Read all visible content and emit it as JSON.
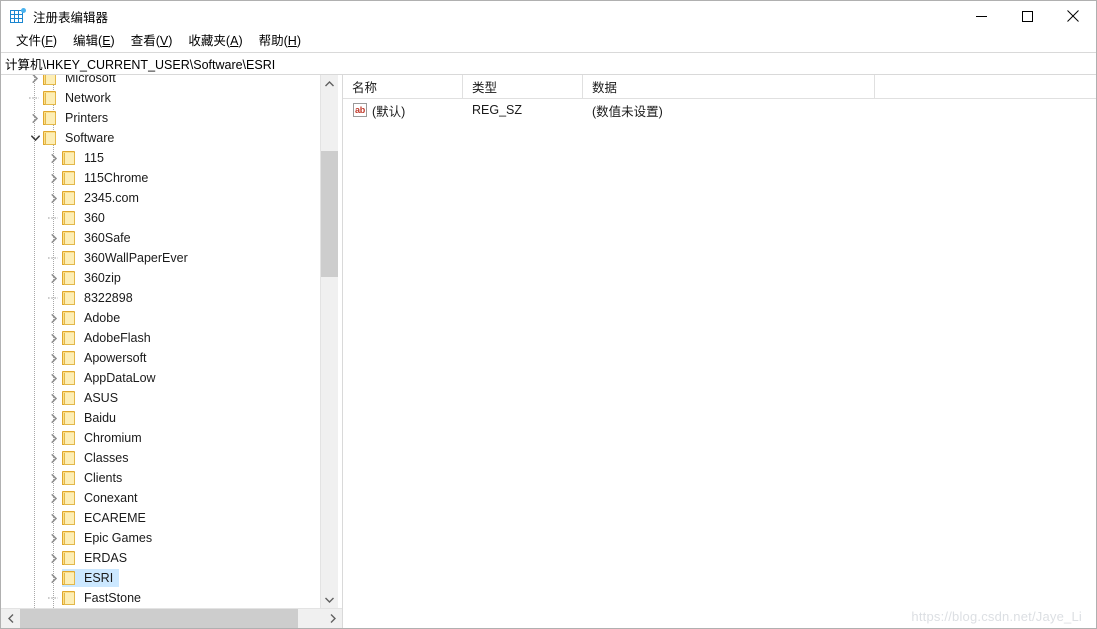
{
  "window": {
    "title": "注册表编辑器",
    "icon": "registry-icon",
    "controls": {
      "minimize": "—",
      "maximize": "□",
      "close": "✕"
    }
  },
  "menubar": {
    "items": [
      {
        "label": "文件",
        "accel": "F"
      },
      {
        "label": "编辑",
        "accel": "E"
      },
      {
        "label": "查看",
        "accel": "V"
      },
      {
        "label": "收藏夹",
        "accel": "A"
      },
      {
        "label": "帮助",
        "accel": "H"
      }
    ]
  },
  "address": {
    "path": "计算机\\HKEY_CURRENT_USER\\Software\\ESRI"
  },
  "tree": {
    "nodes": [
      {
        "label": "Microsoft",
        "depth": 1,
        "expandable": true,
        "expanded": false,
        "selected": false
      },
      {
        "label": "Network",
        "depth": 1,
        "expandable": false,
        "expanded": false,
        "selected": false
      },
      {
        "label": "Printers",
        "depth": 1,
        "expandable": true,
        "expanded": false,
        "selected": false
      },
      {
        "label": "Software",
        "depth": 1,
        "expandable": true,
        "expanded": true,
        "selected": false
      },
      {
        "label": "115",
        "depth": 2,
        "expandable": true,
        "expanded": false,
        "selected": false
      },
      {
        "label": "115Chrome",
        "depth": 2,
        "expandable": true,
        "expanded": false,
        "selected": false
      },
      {
        "label": "2345.com",
        "depth": 2,
        "expandable": true,
        "expanded": false,
        "selected": false
      },
      {
        "label": "360",
        "depth": 2,
        "expandable": false,
        "expanded": false,
        "selected": false
      },
      {
        "label": "360Safe",
        "depth": 2,
        "expandable": true,
        "expanded": false,
        "selected": false
      },
      {
        "label": "360WallPaperEver",
        "depth": 2,
        "expandable": false,
        "expanded": false,
        "selected": false
      },
      {
        "label": "360zip",
        "depth": 2,
        "expandable": true,
        "expanded": false,
        "selected": false
      },
      {
        "label": "8322898",
        "depth": 2,
        "expandable": false,
        "expanded": false,
        "selected": false
      },
      {
        "label": "Adobe",
        "depth": 2,
        "expandable": true,
        "expanded": false,
        "selected": false
      },
      {
        "label": "AdobeFlash",
        "depth": 2,
        "expandable": true,
        "expanded": false,
        "selected": false
      },
      {
        "label": "Apowersoft",
        "depth": 2,
        "expandable": true,
        "expanded": false,
        "selected": false
      },
      {
        "label": "AppDataLow",
        "depth": 2,
        "expandable": true,
        "expanded": false,
        "selected": false
      },
      {
        "label": "ASUS",
        "depth": 2,
        "expandable": true,
        "expanded": false,
        "selected": false
      },
      {
        "label": "Baidu",
        "depth": 2,
        "expandable": true,
        "expanded": false,
        "selected": false
      },
      {
        "label": "Chromium",
        "depth": 2,
        "expandable": true,
        "expanded": false,
        "selected": false
      },
      {
        "label": "Classes",
        "depth": 2,
        "expandable": true,
        "expanded": false,
        "selected": false
      },
      {
        "label": "Clients",
        "depth": 2,
        "expandable": true,
        "expanded": false,
        "selected": false
      },
      {
        "label": "Conexant",
        "depth": 2,
        "expandable": true,
        "expanded": false,
        "selected": false
      },
      {
        "label": "ECAREME",
        "depth": 2,
        "expandable": true,
        "expanded": false,
        "selected": false
      },
      {
        "label": "Epic Games",
        "depth": 2,
        "expandable": true,
        "expanded": false,
        "selected": false
      },
      {
        "label": "ERDAS",
        "depth": 2,
        "expandable": true,
        "expanded": false,
        "selected": false
      },
      {
        "label": "ESRI",
        "depth": 2,
        "expandable": true,
        "expanded": false,
        "selected": true
      },
      {
        "label": "FastStone",
        "depth": 2,
        "expandable": false,
        "expanded": false,
        "selected": false
      }
    ]
  },
  "values": {
    "columns": [
      "名称",
      "类型",
      "数据"
    ],
    "rows": [
      {
        "name": "(默认)",
        "icon": "string-value-icon",
        "type": "REG_SZ",
        "data": "(数值未设置)"
      }
    ]
  },
  "watermark": {
    "text": "https://blog.csdn.net/Jaye_Li"
  },
  "colors": {
    "selection": "#cce8ff",
    "folder_fill": "#fdeeb6",
    "folder_border": "#dfa72e",
    "accent": "#1a86d0",
    "scrollbar_thumb": "#cdcdcd",
    "watermark": "#dcdfe3"
  }
}
